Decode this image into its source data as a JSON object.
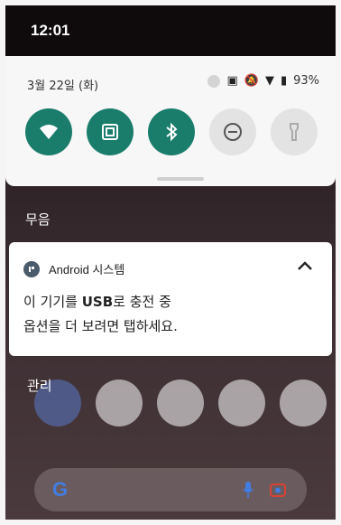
{
  "status_bar": {
    "time": "12:01"
  },
  "quick_settings": {
    "date": "3월 22일 (화)",
    "battery": "93%",
    "tiles": [
      {
        "name": "wifi",
        "state": "on"
      },
      {
        "name": "nfc",
        "state": "on"
      },
      {
        "name": "bluetooth",
        "state": "on"
      },
      {
        "name": "do-not-disturb",
        "state": "off"
      },
      {
        "name": "flashlight",
        "state": "off"
      }
    ]
  },
  "silent_label": "무음",
  "notification": {
    "app": "Android 시스템",
    "title_prefix": "이 기기를 ",
    "title_usb": "USB",
    "title_suffix": "로 충전 중",
    "text": "옵션을 더 보려면 탭하세요."
  },
  "manage_label": "관리",
  "colors": {
    "accent": "#1a7d6c",
    "panel": "#f7f7f7"
  }
}
